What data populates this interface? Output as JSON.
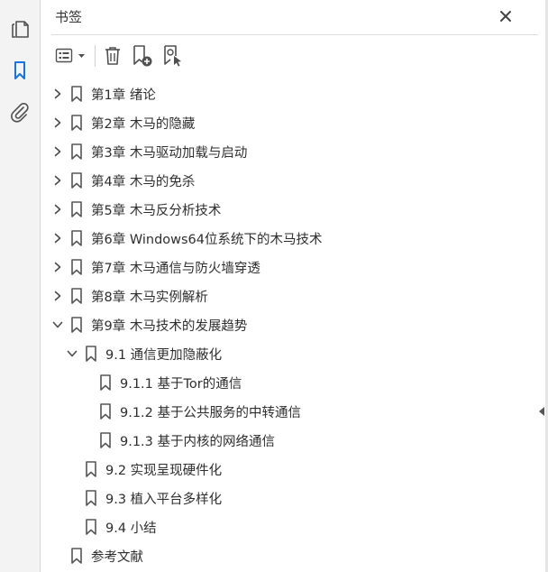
{
  "panel": {
    "title": "书签"
  },
  "rail": {
    "icons": [
      "pages-icon",
      "bookmark-icon",
      "attachment-icon"
    ]
  },
  "toolbar": {
    "icons": [
      "options-menu-icon",
      "delete-icon",
      "new-bookmark-icon",
      "bookmark-from-selection-icon"
    ]
  },
  "bookmarks": [
    {
      "label": "第1章 绪论",
      "level": 0,
      "expand": "collapsed"
    },
    {
      "label": "第2章 木马的隐藏",
      "level": 0,
      "expand": "collapsed"
    },
    {
      "label": "第3章 木马驱动加载与启动",
      "level": 0,
      "expand": "collapsed"
    },
    {
      "label": "第4章 木马的免杀",
      "level": 0,
      "expand": "collapsed"
    },
    {
      "label": "第5章 木马反分析技术",
      "level": 0,
      "expand": "collapsed"
    },
    {
      "label": "第6章 Windows64位系统下的木马技术",
      "level": 0,
      "expand": "collapsed"
    },
    {
      "label": "第7章 木马通信与防火墙穿透",
      "level": 0,
      "expand": "collapsed"
    },
    {
      "label": "第8章 木马实例解析",
      "level": 0,
      "expand": "collapsed"
    },
    {
      "label": "第9章 木马技术的发展趋势",
      "level": 0,
      "expand": "expanded"
    },
    {
      "label": "9.1 通信更加隐蔽化",
      "level": 1,
      "expand": "expanded"
    },
    {
      "label": "9.1.1 基于Tor的通信",
      "level": 2,
      "expand": "none"
    },
    {
      "label": "9.1.2 基于公共服务的中转通信",
      "level": 2,
      "expand": "none"
    },
    {
      "label": "9.1.3 基于内核的网络通信",
      "level": 2,
      "expand": "none"
    },
    {
      "label": "9.2 实现呈现硬件化",
      "level": 1,
      "expand": "none"
    },
    {
      "label": "9.3 植入平台多样化",
      "level": 1,
      "expand": "none"
    },
    {
      "label": "9.4 小结",
      "level": 1,
      "expand": "none"
    },
    {
      "label": "参考文献",
      "level": 0,
      "expand": "none"
    }
  ],
  "colors": {
    "accent": "#1473e6",
    "icon": "#505050",
    "rail_bg": "#f3f3f3"
  }
}
